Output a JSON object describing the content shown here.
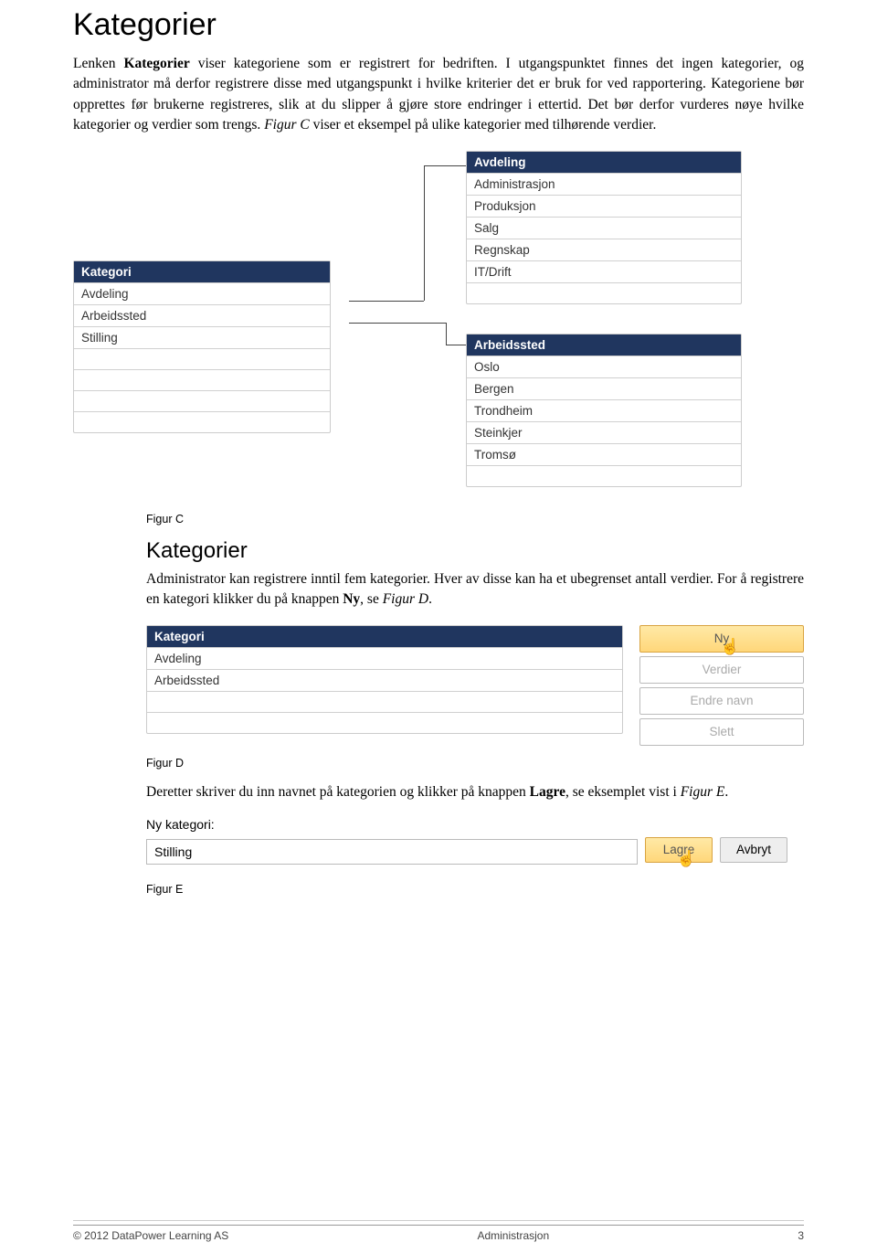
{
  "title": "Kategorier",
  "intro_parts": {
    "p1": "Lenken ",
    "kategorier_bold": "Kategorier",
    "p2": " viser kategoriene som er registrert for bedriften. I utgangspunktet finnes det ingen kategorier, og administrator må derfor registrere disse med utgangspunkt i hvilke kriterier det er bruk for ved rapportering. Kategoriene bør opprettes før brukerne registreres, slik at du slipper å gjøre store endringer i ettertid. Det bør derfor vurderes nøye hvilke kategorier og verdier som trengs. ",
    "figc_ref": "Figur C",
    "p3": " viser et eksempel på ulike kategorier med tilhørende verdier."
  },
  "figC": {
    "kategori": {
      "header": "Kategori",
      "rows": [
        "Avdeling",
        "Arbeidssted",
        "Stilling"
      ]
    },
    "avdeling": {
      "header": "Avdeling",
      "rows": [
        "Administrasjon",
        "Produksjon",
        "Salg",
        "Regnskap",
        "IT/Drift"
      ]
    },
    "arbeidssted": {
      "header": "Arbeidssted",
      "rows": [
        "Oslo",
        "Bergen",
        "Trondheim",
        "Steinkjer",
        "Tromsø"
      ]
    },
    "caption": "Figur C"
  },
  "section2": {
    "heading": "Kategorier",
    "p1": "Administrator kan registrere inntil fem kategorier. Hver av disse kan ha et ubegrenset antall verdier. For å registrere en kategori klikker du på knappen ",
    "ny_bold": "Ny",
    "p2": ", se ",
    "figd_ref": "Figur D",
    "p3": "."
  },
  "figD": {
    "kategori": {
      "header": "Kategori",
      "rows": [
        "Avdeling",
        "Arbeidssted"
      ]
    },
    "buttons": {
      "ny": "Ny",
      "verdier": "Verdier",
      "endre": "Endre navn",
      "slett": "Slett"
    },
    "caption": "Figur D"
  },
  "paraE": {
    "p1": "Deretter skriver du inn navnet på kategorien og klikker på knappen ",
    "lagre_bold": "Lagre",
    "p2": ", se eksemplet vist i ",
    "fige_ref": "Figur E",
    "p3": "."
  },
  "figE": {
    "label": "Ny kategori:",
    "value": "Stilling",
    "lagre": "Lagre",
    "avbryt": "Avbryt",
    "caption": "Figur E"
  },
  "footer": {
    "left": "© 2012 DataPower Learning AS",
    "center": "Administrasjon",
    "right": "3"
  }
}
